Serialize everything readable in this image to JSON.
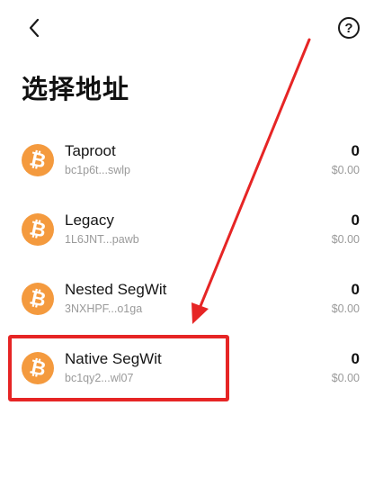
{
  "header": {
    "back_icon": "chevron-left-icon",
    "help_icon": "question-circle-icon",
    "help_glyph": "?"
  },
  "page": {
    "title": "选择地址"
  },
  "addresses": [
    {
      "icon": "bitcoin-icon",
      "glyph": "₿",
      "name": "Taproot",
      "address": "bc1p6t...swlp",
      "amount": "0",
      "fiat": "$0.00"
    },
    {
      "icon": "bitcoin-icon",
      "glyph": "₿",
      "name": "Legacy",
      "address": "1L6JNT...pawb",
      "amount": "0",
      "fiat": "$0.00"
    },
    {
      "icon": "bitcoin-icon",
      "glyph": "₿",
      "name": "Nested SegWit",
      "address": "3NXHPF...o1ga",
      "amount": "0",
      "fiat": "$0.00"
    },
    {
      "icon": "bitcoin-icon",
      "glyph": "₿",
      "name": "Native SegWit",
      "address": "bc1qy2...wl07",
      "amount": "0",
      "fiat": "$0.00"
    }
  ],
  "colors": {
    "bitcoin": "#f49a3e",
    "highlight": "#e62525",
    "secondary_text": "#9a9a9a"
  }
}
